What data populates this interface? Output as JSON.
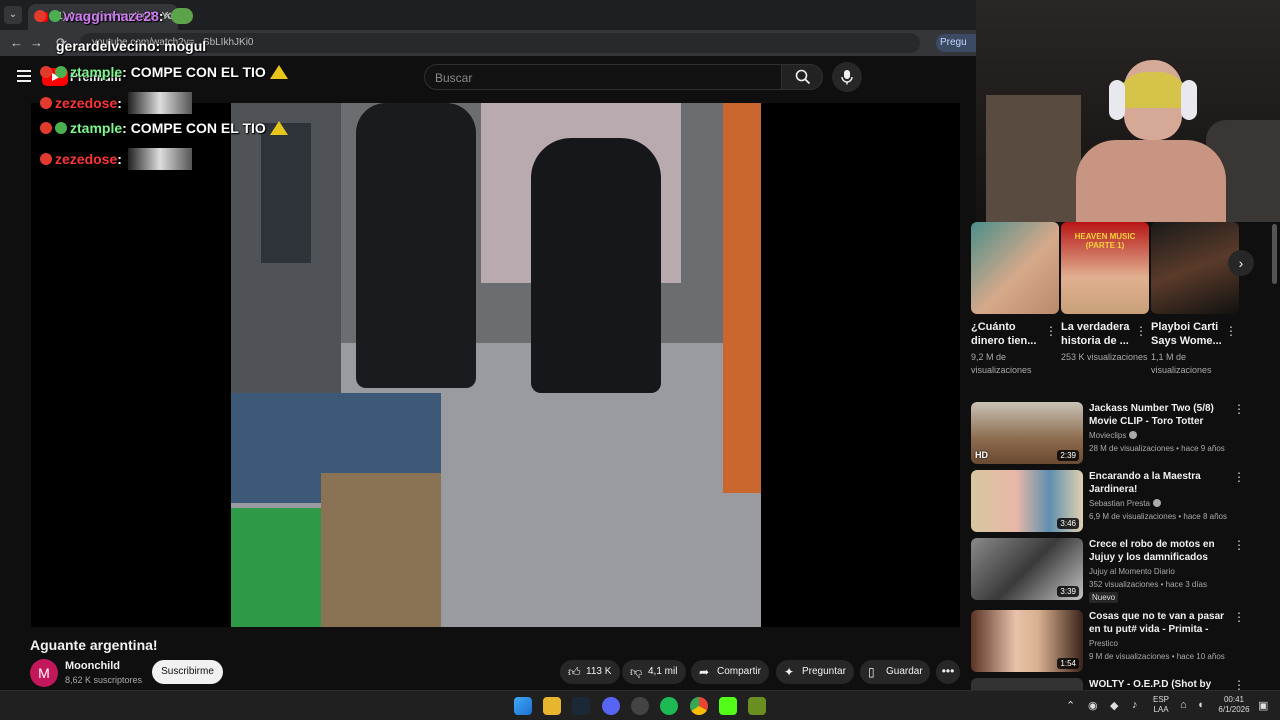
{
  "browser": {
    "tab_title": "(1) Aguante argentina! - YouTube",
    "address": "youtube.com/watch?v=...SbLIkhJKi0",
    "ask_label": "Pregu"
  },
  "header": {
    "premium_label": "Premium",
    "search_placeholder": "Buscar"
  },
  "chat": [
    {
      "user": "wagginhaze28",
      "text": ""
    },
    {
      "user": "gerardelvecino",
      "text": "mogul"
    },
    {
      "user": "ztample",
      "text": "COMPE CON EL TIO"
    },
    {
      "user": "zezedose",
      "text": ""
    },
    {
      "user": "ztample",
      "text": "COMPE CON EL TIO"
    },
    {
      "user": "zezedose",
      "text": ""
    }
  ],
  "video": {
    "title": "Aguante argentina!",
    "channel": "Moonchild",
    "avatar_letter": "M",
    "subscribers": "8,62 K suscriptores",
    "subscribe_label": "Suscribirme",
    "likes": "113 K",
    "dislikes": "4,1 mil",
    "share_label": "Compartir",
    "ask_label": "Preguntar",
    "save_label": "Guardar"
  },
  "shorts": [
    {
      "title": "¿Cuánto dinero tien...",
      "views": "9,2 M de visualizaciones"
    },
    {
      "title": "La verdadera historia de ...",
      "views": "253 K visualizaciones",
      "overlay": "HEAVEN MUSIC (PARTE 1)"
    },
    {
      "title": "Playboi Carti Says Wome...",
      "views": "1,1 M de visualizaciones"
    }
  ],
  "recommendations": [
    {
      "title": "Jackass Number Two (5/8) Movie CLIP - Toro Totter (2006...",
      "channel": "Movieclips",
      "verified": true,
      "meta": "28 M de visualizaciones • hace 9 años",
      "duration": "2:39",
      "hd": "HD",
      "new": ""
    },
    {
      "title": "Encarando a la Maestra Jardinera!",
      "channel": "Sebastian Presta",
      "verified": true,
      "meta": "6,9 M de visualizaciones • hace 8 años",
      "duration": "3:46",
      "hd": "",
      "new": ""
    },
    {
      "title": "Crece el robo de motos en Jujuy y los damnificados exigen ...",
      "channel": "Jujuy al Momento Diario",
      "verified": false,
      "meta": "352 visualizaciones • hace 3 días",
      "duration": "3:39",
      "hd": "",
      "new": "Nuevo"
    },
    {
      "title": "Cosas que no te van a pasar en tu put# vida - Primita - Prestico",
      "channel": "Prestico",
      "verified": false,
      "meta": "9 M de visualizaciones • hace 10 años",
      "duration": "1:54",
      "hd": "",
      "new": ""
    },
    {
      "title": "WOLTY - O.E.P.D (Shot by",
      "channel": "",
      "verified": false,
      "meta": "",
      "duration": "",
      "hd": "",
      "new": ""
    }
  ],
  "taskbar": {
    "lang_top": "ESP",
    "lang_bottom": "LAA",
    "time": "00:41",
    "date": "6/1/2026"
  },
  "colors": {
    "yt_red": "#ff0000",
    "background": "#0f0f0f",
    "chip": "#272727"
  }
}
